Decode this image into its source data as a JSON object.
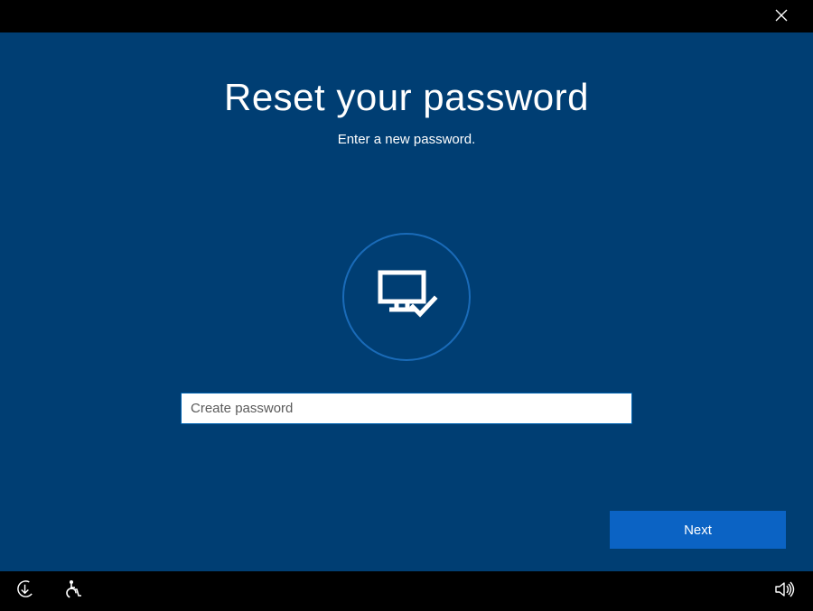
{
  "header": {
    "close_label": "✕"
  },
  "main": {
    "title": "Reset your password",
    "subtitle": "Enter a new password.",
    "password_placeholder": "Create password",
    "password_value": "",
    "next_label": "Next"
  },
  "icons": {
    "monitor_check": "monitor-check-icon",
    "ease_of_access": "ease-of-access-icon",
    "microphone": "microphone-icon",
    "volume": "volume-icon"
  }
}
